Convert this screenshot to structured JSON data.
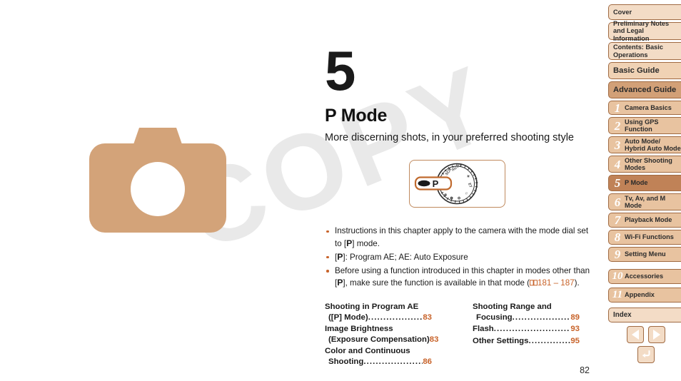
{
  "document": {
    "page_number": "82",
    "watermark": "COPY"
  },
  "chapter": {
    "number": "5",
    "title": "P Mode",
    "subtitle": "More discerning shots, in your preferred shooting style"
  },
  "figure": {
    "name": "mode-dial",
    "callout_label": "P"
  },
  "bullets": [
    {
      "pre": "Instructions in this chapter apply to the camera with the mode dial set to [",
      "bold": "P",
      "post": "] mode.",
      "has_ref": false
    },
    {
      "pre": "[",
      "bold": "P",
      "post": "]: Program AE; AE: Auto Exposure",
      "has_ref": false
    },
    {
      "pre": "Before using a function introduced in this chapter in modes other than [",
      "bold": "P",
      "post": "], make sure the function is available in that mode (",
      "has_ref": true,
      "ref_start": "181",
      "ref_dash": " – ",
      "ref_end": "187",
      "tail": ")."
    }
  ],
  "toc": {
    "left": [
      {
        "line1": "Shooting in Program AE",
        "line2": "([P] Mode)",
        "page": "83"
      },
      {
        "line1": "Image Brightness",
        "line2": "(Exposure Compensation)",
        "page": "83"
      },
      {
        "line1": "Color and Continuous",
        "line2": "Shooting",
        "page": "86"
      }
    ],
    "right": [
      {
        "line1": "Shooting Range and",
        "line2": "Focusing",
        "page": "89"
      },
      {
        "line1": "",
        "line2": "Flash",
        "page": "93",
        "single": true
      },
      {
        "line1": "",
        "line2": "Other Settings",
        "page": "95",
        "single": true
      }
    ]
  },
  "sidebar": {
    "top_tabs": [
      {
        "label": "Cover",
        "type": "lvl1"
      },
      {
        "label": "Preliminary Notes\nand Legal Information",
        "type": "lvl1"
      },
      {
        "label": "Contents: Basic\nOperations",
        "type": "lvl1"
      },
      {
        "label": "Basic Guide",
        "type": "guide"
      },
      {
        "label": "Advanced Guide",
        "type": "active-guide"
      }
    ],
    "chapters": [
      {
        "num": "1",
        "label": "Camera Basics",
        "active": false
      },
      {
        "num": "2",
        "label": "Using GPS\nFunction",
        "active": false
      },
      {
        "num": "3",
        "label": "Auto Mode/\nHybrid Auto Mode",
        "active": false
      },
      {
        "num": "4",
        "label": "Other Shooting\nModes",
        "active": false
      },
      {
        "num": "5",
        "label": "P Mode",
        "active": true
      },
      {
        "num": "6",
        "label": "Tv, Av, and M\nMode",
        "active": false
      },
      {
        "num": "7",
        "label": "Playback Mode",
        "active": false
      },
      {
        "num": "8",
        "label": "Wi-Fi Functions",
        "active": false
      },
      {
        "num": "9",
        "label": "Setting Menu",
        "active": false
      },
      {
        "num": "10",
        "label": "Accessories",
        "active": false
      },
      {
        "num": "11",
        "label": "Appendix",
        "active": false
      }
    ],
    "index_tab": {
      "label": "Index"
    },
    "nav": {
      "prev_label": "previous-page",
      "next_label": "next-page",
      "back_label": "return"
    }
  },
  "colors": {
    "accent": "#c8632a",
    "tab_bg": "#f3dcc6",
    "tab_border": "#a06a42",
    "active_chapter": "#c08257",
    "camera_art": "#d3a379"
  }
}
